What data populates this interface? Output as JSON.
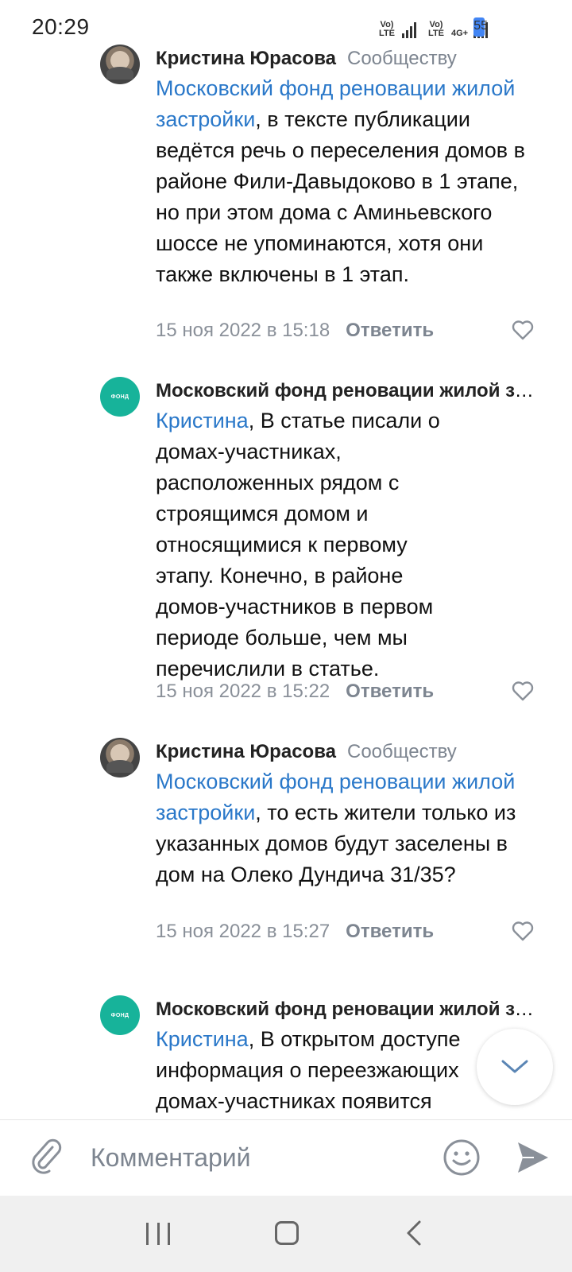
{
  "status_bar": {
    "time": "20:29",
    "sim1_label": "Vo) LTE",
    "sim2_label": "Vo) LTE",
    "network": "4G+",
    "battery": "55",
    "battery_color": "#4285f4"
  },
  "colors": {
    "link": "#2a78c9",
    "muted": "#7d8590",
    "fund_avatar": "#17b39a"
  },
  "comments": [
    {
      "author": "Кристина Юрасова",
      "target": "Сообществу",
      "mention": "Московский фонд реновации жилой застройки",
      "text": ", в тексте публикации ведётся речь о переселения домов в районе Фили-Давыдоково в 1 этапе, но при этом дома с Аминьевского шоссе не упоминаются, хотя они также включены в 1 этап.",
      "date": "15 ноя 2022 в 15:18",
      "reply": "Ответить"
    },
    {
      "author": "Московский фонд реновации жилой застройки",
      "mention": "Кристина",
      "text": ", В статье писали о домах-участниках, расположенных рядом с строящимся домом и относящимися к первому этапу. Конечно, в районе домов-участников в первом периоде больше, чем мы перечислили в статье.",
      "date": "15 ноя 2022 в 15:22",
      "reply": "Ответить"
    },
    {
      "author": "Кристина Юрасова",
      "target": "Сообществу",
      "mention": "Московский фонд реновации жилой застройки",
      "text": ", то есть жители только из указанных домов будут заселены в дом на Олеко Дундича 31/35?",
      "date": "15 ноя 2022 в 15:27",
      "reply": "Ответить"
    },
    {
      "author": "Московский фонд реновации жилой застройки",
      "mention": "Кристина",
      "text": ", В открытом доступе информация о переезжающих домах-участниках появится",
      "date": "",
      "reply": ""
    }
  ],
  "input": {
    "placeholder": "Комментарий"
  },
  "icons": {
    "attach": "paperclip-icon",
    "emoji": "smiley-icon",
    "send": "send-icon",
    "like": "heart-icon",
    "scroll": "chevron-down-icon"
  }
}
